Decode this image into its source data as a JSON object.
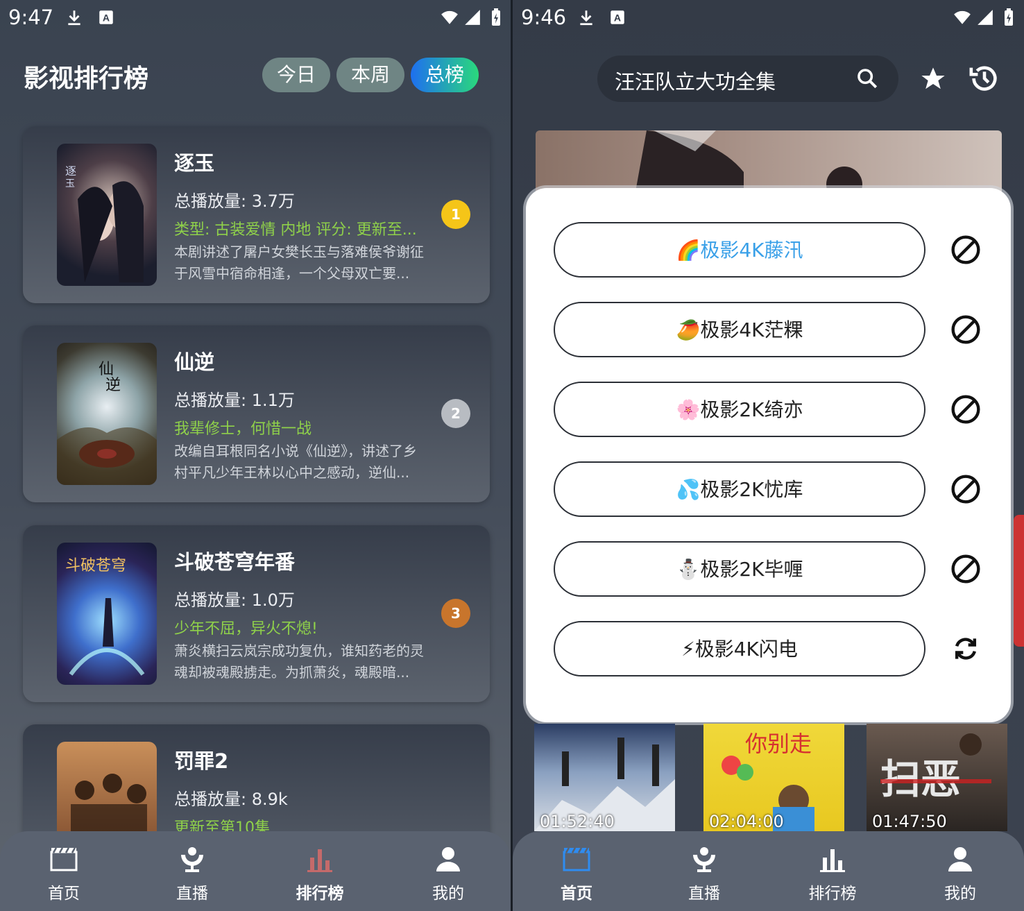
{
  "left": {
    "status": {
      "time": "9:47"
    },
    "header": {
      "title": "影视排行榜",
      "segments": [
        "今日",
        "本周",
        "总榜"
      ],
      "active_segment": "总榜"
    },
    "cards": [
      {
        "title": "逐玉",
        "plays": "总播放量: 3.7万",
        "tag": "类型: 古装爱情 内地 评分:   更新至...",
        "desc": "本剧讲述了屠户女樊长玉与落难侯爷谢征于风雪中宿命相逢，一个父母双亡要...",
        "rank": "1",
        "rank_color": "#f5c518"
      },
      {
        "title": "仙逆",
        "plays": "总播放量: 1.1万",
        "tag": "我辈修士，何惜一战",
        "desc": "改编自耳根同名小说《仙逆》，讲述了乡村平凡少年王林以心中之感动，逆仙...",
        "rank": "2",
        "rank_color": "#b8bcc2"
      },
      {
        "title": "斗破苍穹年番",
        "plays": "总播放量: 1.0万",
        "tag": "少年不屈，异火不熄!",
        "desc": "萧炎横扫云岚宗成功复仇，谁知药老的灵魂却被魂殿掳走。为抓萧炎，魂殿暗...",
        "rank": "3",
        "rank_color": "#c8752c"
      },
      {
        "title": "罚罪2",
        "plays": "总播放量: 8.9k",
        "tag": "更新至第10集",
        "desc": "",
        "rank": "",
        "rank_color": ""
      }
    ],
    "nav": [
      {
        "label": "首页",
        "icon": "clapperboard-icon"
      },
      {
        "label": "直播",
        "icon": "satellite-dish-icon"
      },
      {
        "label": "排行榜",
        "icon": "bar-chart-icon"
      },
      {
        "label": "我的",
        "icon": "user-icon"
      }
    ],
    "nav_active": "排行榜"
  },
  "right": {
    "status": {
      "time": "9:46"
    },
    "search": {
      "value": "汪汪队立大功全集"
    },
    "sources": [
      {
        "emoji": "🌈",
        "name": "极影4K藤汛",
        "highlighted": true,
        "action": "disabled-icon"
      },
      {
        "emoji": "🥭",
        "name": "极影4K茫粿",
        "highlighted": false,
        "action": "disabled-icon"
      },
      {
        "emoji": "🌸",
        "name": "极影2K绮亦",
        "highlighted": false,
        "action": "disabled-icon"
      },
      {
        "emoji": "💦",
        "name": "极影2K忧库",
        "highlighted": false,
        "action": "disabled-icon"
      },
      {
        "emoji": "⛄",
        "name": "极影2K毕喱",
        "highlighted": false,
        "action": "disabled-icon"
      },
      {
        "emoji": "⚡",
        "name": "极影4K闪电",
        "highlighted": false,
        "action": "refresh-icon"
      }
    ],
    "thumbs": [
      {
        "time": "01:52:40"
      },
      {
        "time": "02:04:00"
      },
      {
        "time": "01:47:50"
      }
    ],
    "nav": [
      {
        "label": "首页",
        "icon": "clapperboard-icon"
      },
      {
        "label": "直播",
        "icon": "satellite-dish-icon"
      },
      {
        "label": "排行榜",
        "icon": "bar-chart-icon"
      },
      {
        "label": "我的",
        "icon": "user-icon"
      }
    ],
    "nav_active": "首页"
  },
  "colors": {
    "accent_blue": "#2f8cf0",
    "highlight_text": "#3aa0e8",
    "tag_green": "#8fd14a",
    "active_seg_start": "#1e6ff0",
    "active_seg_end": "#2ad97c"
  }
}
